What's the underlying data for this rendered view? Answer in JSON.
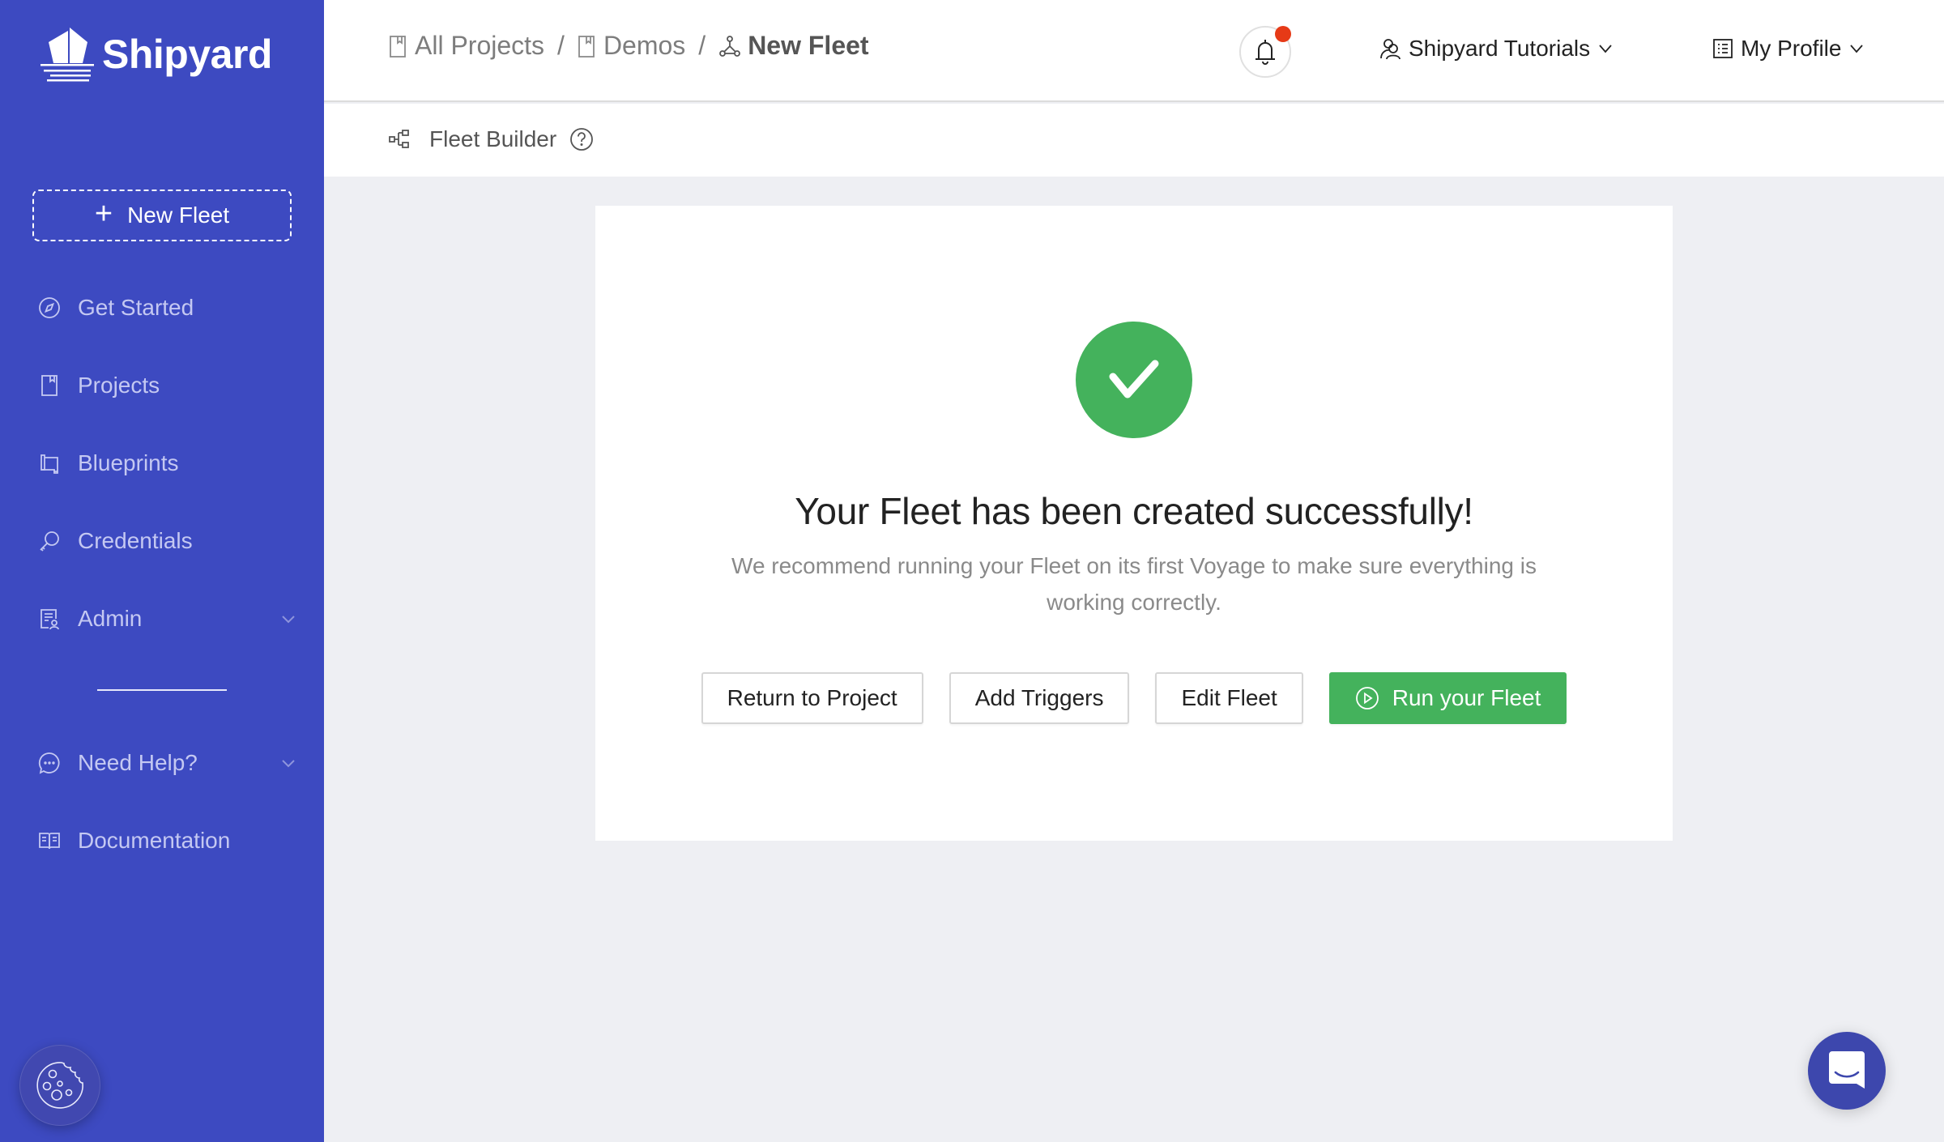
{
  "brand": {
    "name": "Shipyard",
    "sidebar_color": "#3d4ac1",
    "accent_green": "#44b25c",
    "notification_dot_color": "#e63a17"
  },
  "sidebar": {
    "new_fleet_label": "New Fleet",
    "items": [
      {
        "label": "Get Started",
        "icon": "compass-icon",
        "has_chevron": false
      },
      {
        "label": "Projects",
        "icon": "bookmark-book-icon",
        "has_chevron": false
      },
      {
        "label": "Blueprints",
        "icon": "blueprint-scroll-icon",
        "has_chevron": false
      },
      {
        "label": "Credentials",
        "icon": "key-icon",
        "has_chevron": false
      },
      {
        "label": "Admin",
        "icon": "admin-certificate-icon",
        "has_chevron": true
      },
      {
        "label": "Need Help?",
        "icon": "chat-bubble-icon",
        "has_chevron": true
      },
      {
        "label": "Documentation",
        "icon": "open-book-icon",
        "has_chevron": false
      }
    ],
    "cookie_button_icon": "cookie-icon"
  },
  "header": {
    "breadcrumb": [
      {
        "label": "All Projects",
        "icon": "bookmark-book-icon"
      },
      {
        "label": "Demos",
        "icon": "bookmark-book-icon"
      },
      {
        "label": "New Fleet",
        "icon": "fleet-nodes-icon"
      }
    ],
    "separator": "/",
    "notifications": {
      "icon": "bell-icon",
      "has_unread": true
    },
    "org_menu_label": "Shipyard Tutorials",
    "profile_menu_label": "My Profile"
  },
  "subheader": {
    "title": "Fleet Builder",
    "icon": "fleet-tree-icon",
    "help_icon": "help-circle-icon"
  },
  "card": {
    "status_icon": "check-circle-icon",
    "title": "Your Fleet has been created successfully!",
    "description": "We recommend running your Fleet on its first Voyage to make sure everything is working correctly.",
    "buttons": {
      "return_to_project": "Return to Project",
      "add_triggers": "Add Triggers",
      "edit_fleet": "Edit Fleet",
      "run_fleet": "Run your Fleet"
    }
  },
  "chat_launcher": {
    "icon": "chat-launcher-icon"
  }
}
